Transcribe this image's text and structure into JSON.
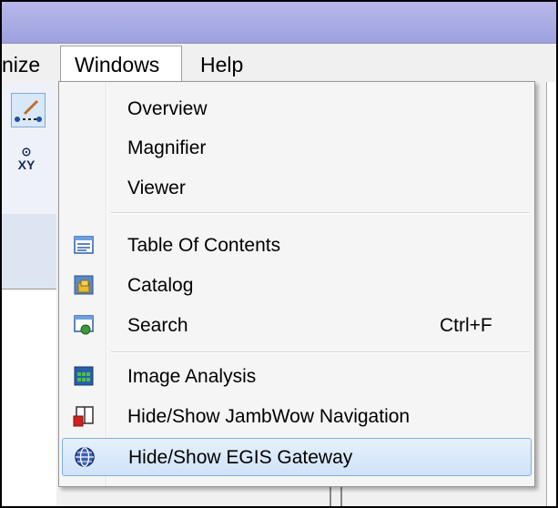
{
  "menubar": {
    "items": [
      {
        "label": "nize"
      },
      {
        "label": "Windows"
      },
      {
        "label": "Help"
      }
    ]
  },
  "toolbar": {
    "xy_label": "XY"
  },
  "dropdown": {
    "items": [
      {
        "label": "Overview",
        "icon": null
      },
      {
        "label": "Magnifier",
        "icon": null
      },
      {
        "label": "Viewer",
        "icon": null
      },
      {
        "label": "Table Of Contents",
        "icon": "table-of-contents-icon"
      },
      {
        "label": "Catalog",
        "icon": "catalog-icon"
      },
      {
        "label": "Search",
        "icon": "search-window-icon",
        "shortcut": "Ctrl+F"
      },
      {
        "label": "Image Analysis",
        "icon": "image-analysis-icon"
      },
      {
        "label": "Hide/Show JambWow Navigation",
        "icon": "jambwow-navigation-icon"
      },
      {
        "label": "Hide/Show EGIS Gateway",
        "icon": "globe-icon",
        "highlighted": true
      }
    ]
  },
  "colors": {
    "title_gradient": "#aeb0e6",
    "highlight_border": "#7daee0",
    "highlight_fill": "#cfe3f8"
  }
}
